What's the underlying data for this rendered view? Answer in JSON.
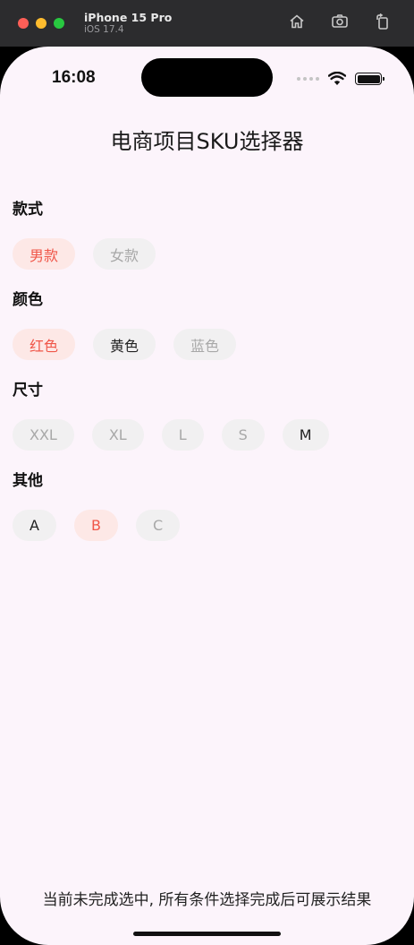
{
  "simulator": {
    "device_name": "iPhone 15 Pro",
    "os_version": "iOS 17.4",
    "tools": [
      {
        "name": "home-icon"
      },
      {
        "name": "screenshot-icon"
      },
      {
        "name": "rotate-icon"
      }
    ]
  },
  "status_bar": {
    "time": "16:08"
  },
  "page": {
    "title": "电商项目SKU选择器",
    "footer": "当前未完成选中, 所有条件选择完成后可展示结果"
  },
  "sections": [
    {
      "title": "款式",
      "options": [
        {
          "label": "男款",
          "state": "selected"
        },
        {
          "label": "女款",
          "state": "disabled"
        }
      ]
    },
    {
      "title": "颜色",
      "options": [
        {
          "label": "红色",
          "state": "selected"
        },
        {
          "label": "黄色",
          "state": "normal"
        },
        {
          "label": "蓝色",
          "state": "disabled"
        }
      ]
    },
    {
      "title": "尺寸",
      "options": [
        {
          "label": "XXL",
          "state": "disabled"
        },
        {
          "label": "XL",
          "state": "disabled"
        },
        {
          "label": "L",
          "state": "disabled"
        },
        {
          "label": "S",
          "state": "disabled"
        },
        {
          "label": "M",
          "state": "normal"
        }
      ]
    },
    {
      "title": "其他",
      "options": [
        {
          "label": "A",
          "state": "normal"
        },
        {
          "label": "B",
          "state": "selected"
        },
        {
          "label": "C",
          "state": "disabled"
        }
      ]
    }
  ],
  "colors": {
    "selected_text": "#f0574a",
    "selected_bg": "#fde8e6",
    "chip_bg": "#f1f0f1",
    "disabled_text": "#a8a8a8",
    "screen_bg": "#fcf4fb"
  }
}
